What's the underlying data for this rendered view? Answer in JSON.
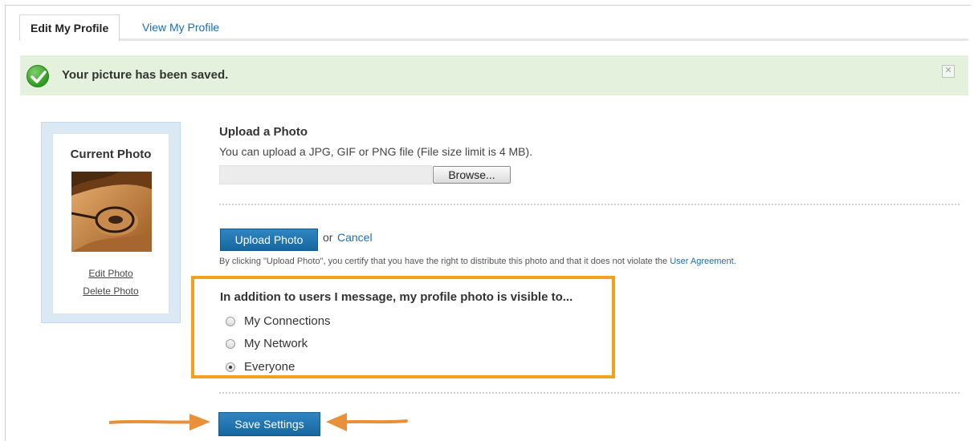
{
  "tabs": {
    "active": "Edit My Profile",
    "other": "View My Profile"
  },
  "banner": {
    "message": "Your picture has been saved.",
    "close_glyph": "✕"
  },
  "current_photo": {
    "title": "Current Photo",
    "edit_link": "Edit Photo",
    "delete_link": "Delete Photo"
  },
  "upload": {
    "title": "Upload a Photo",
    "description": "You can upload a JPG, GIF or PNG file (File size limit is 4 MB).",
    "file_value": "",
    "browse_label": "Browse...",
    "upload_button": "Upload Photo",
    "or_text": "or",
    "cancel_link": "Cancel",
    "legal_text": "By clicking \"Upload Photo\", you certify that you have the right to distribute this photo and that it does not violate the",
    "legal_link": "User Agreement",
    "legal_end": "."
  },
  "visibility": {
    "title": "In addition to users I message, my profile photo is visible to...",
    "options": [
      {
        "label": "My Connections",
        "selected": false
      },
      {
        "label": "My Network",
        "selected": false
      },
      {
        "label": "Everyone",
        "selected": true
      }
    ]
  },
  "save_button": "Save Settings",
  "colors": {
    "highlight": "#f0a21f",
    "arrow": "#e8913a",
    "button_blue": "#1f74b0",
    "banner_green": "#e4f2dd"
  },
  "icons": [
    "check-circle-icon",
    "close-icon",
    "arrow-right-icon",
    "arrow-left-icon"
  ]
}
